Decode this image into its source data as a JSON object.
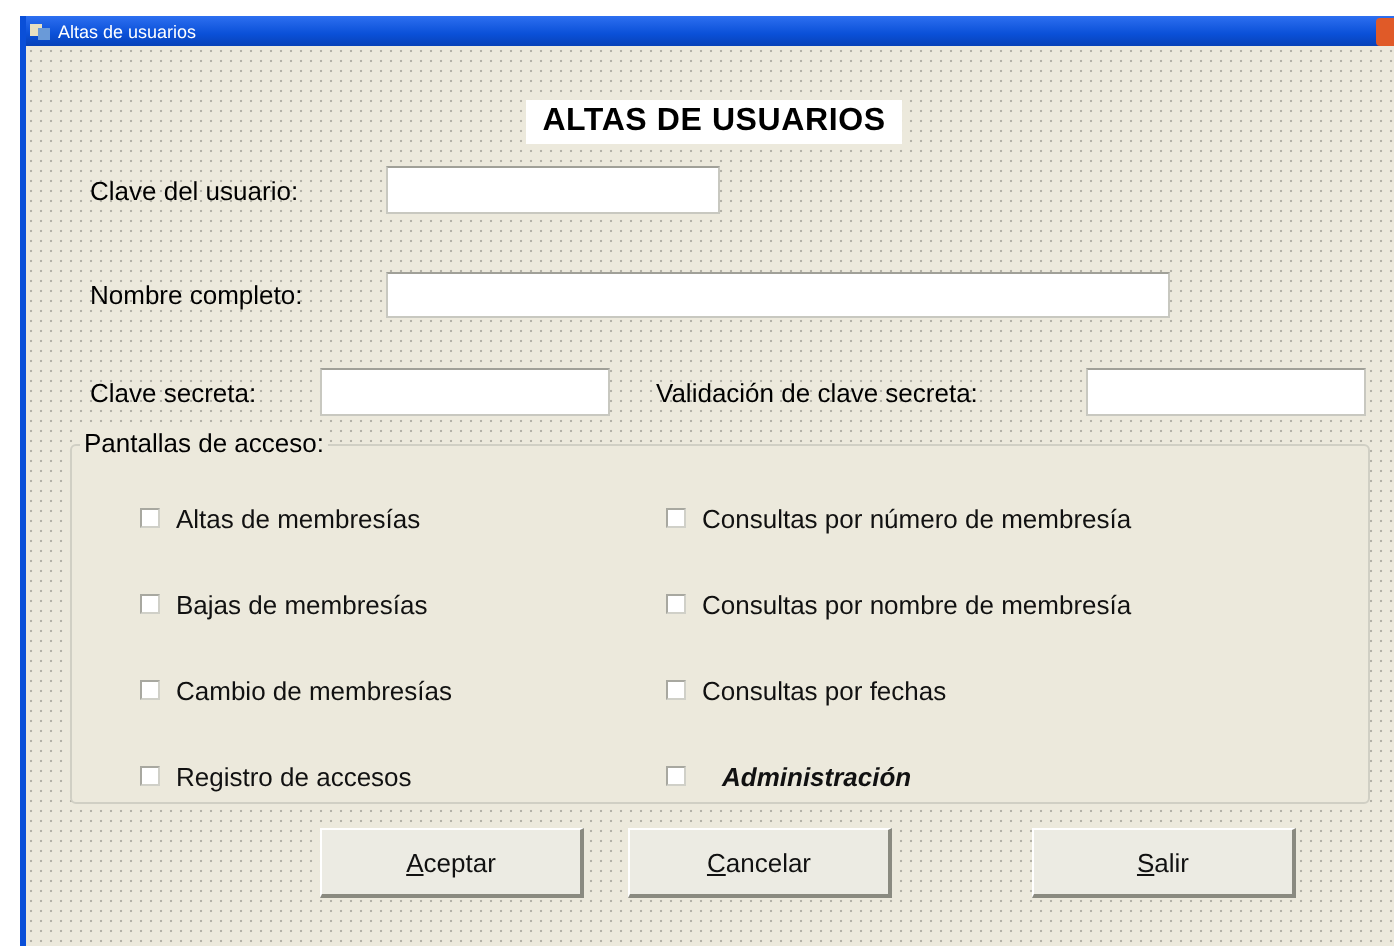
{
  "window": {
    "title": "Altas de usuarios"
  },
  "heading": "ALTAS DE USUARIOS",
  "fields": [
    {
      "label": "Clave del usuario:"
    },
    {
      "label": "Nombre completo:"
    },
    {
      "label": "Clave secreta:"
    },
    {
      "label": "Validación de clave secreta:"
    }
  ],
  "access_group": {
    "title": "Pantallas de acceso:",
    "options": [
      {
        "label": "Altas de membresías",
        "checked": false,
        "kind": "plain"
      },
      {
        "label": "Consultas por número de membresía",
        "checked": false,
        "kind": "plain"
      },
      {
        "label": "Bajas de membresías",
        "checked": false,
        "kind": "plain"
      },
      {
        "label": "Consultas por nombre de membresía",
        "checked": false,
        "kind": "plain"
      },
      {
        "label": "Cambio de membresías",
        "checked": false,
        "kind": "plain"
      },
      {
        "label": "Consultas por fechas",
        "checked": false,
        "kind": "plain"
      },
      {
        "label": "Registro de accesos",
        "checked": false,
        "kind": "plain"
      },
      {
        "label": "Administración",
        "checked": false,
        "kind": "emphasized"
      }
    ]
  },
  "buttons": [
    "Aceptar",
    "Cancelar",
    "Salir"
  ]
}
